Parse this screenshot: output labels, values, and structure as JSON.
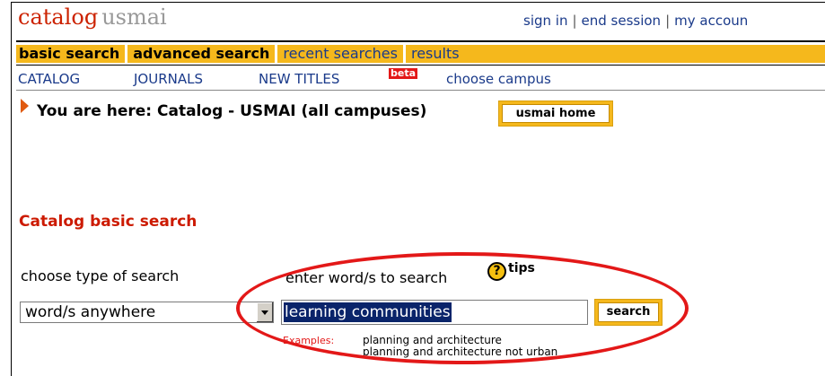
{
  "logo": {
    "part1": "catalog",
    "part2": "usmai"
  },
  "top_links": {
    "sign_in": "sign in",
    "end_session": "end session",
    "my_account": "my accoun",
    "sep": "|"
  },
  "tabs": {
    "basic": "basic search",
    "advanced": "advanced search",
    "recent": "recent searches",
    "results": "results"
  },
  "subnav": {
    "catalog": "CATALOG",
    "journals": "JOURNALS",
    "new_titles": "NEW TITLES",
    "beta": "beta",
    "choose_campus": "choose campus"
  },
  "location": {
    "text": "You are here: Catalog - USMAI (all campuses)",
    "home_button": "usmai home"
  },
  "search": {
    "heading": "Catalog basic search",
    "type_label": "choose type of search",
    "words_label": "enter word/s to search",
    "tips": "tips",
    "type_value": "word/s anywhere",
    "query": "learning communities",
    "button": "search",
    "examples_label": "Examples:",
    "example1": "planning and architecture",
    "example2": "planning and architecture not urban"
  },
  "colors": {
    "accent": "#f5b81c",
    "brand_red": "#cc2200",
    "link": "#1a3a8a",
    "highlight_ring": "#e31818"
  }
}
